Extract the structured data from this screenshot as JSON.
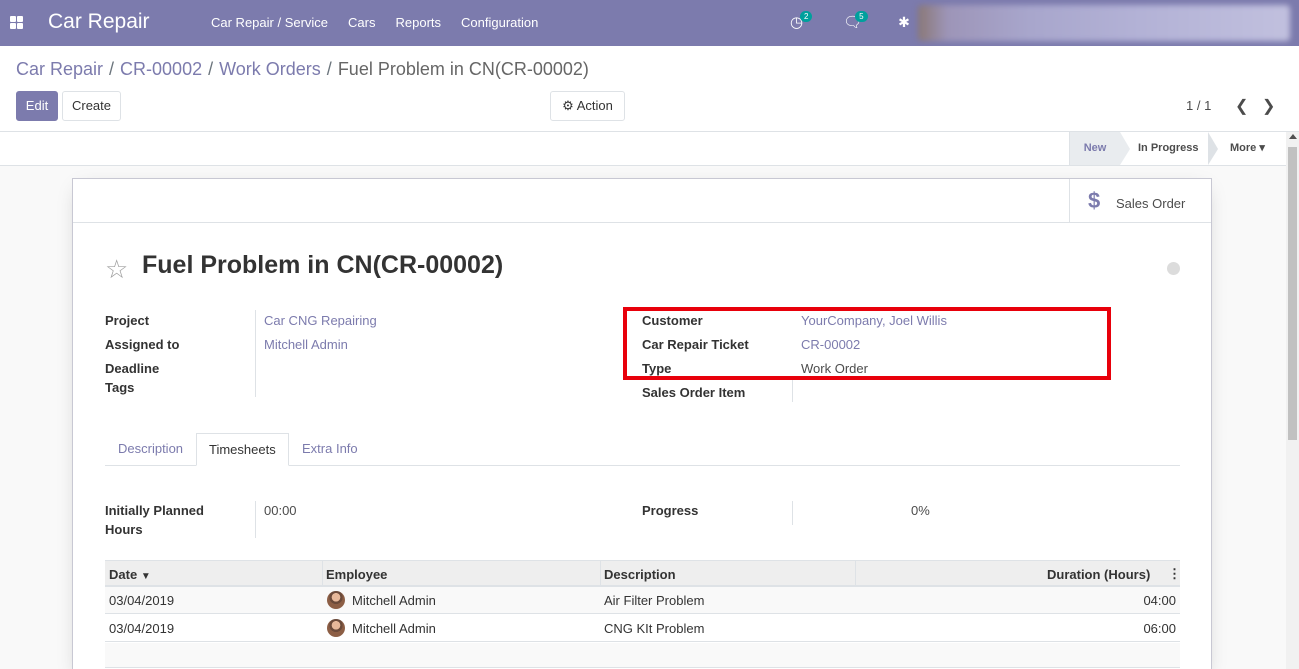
{
  "navbar": {
    "brand": "Car Repair",
    "menu": [
      "Car Repair / Service",
      "Cars",
      "Reports",
      "Configuration"
    ],
    "activity_count": "2",
    "messages_count": "5"
  },
  "breadcrumb": {
    "items": [
      "Car Repair",
      "CR-00002",
      "Work Orders"
    ],
    "current": "Fuel Problem in CN(CR-00002)"
  },
  "buttons": {
    "edit": "Edit",
    "create": "Create",
    "action": "Action"
  },
  "pager": {
    "value": "1 / 1"
  },
  "statusbar": {
    "stages": [
      "New",
      "In Progress",
      "More"
    ],
    "active": "New"
  },
  "smart_button": {
    "label": "Sales Order",
    "icon": "dollar-icon"
  },
  "record": {
    "title": "Fuel Problem in CN(CR-00002)",
    "left_fields": [
      {
        "label": "Project",
        "value": "Car CNG Repairing"
      },
      {
        "label": "Assigned to",
        "value": "Mitchell Admin"
      },
      {
        "label": "Deadline",
        "value": ""
      },
      {
        "label": "Tags",
        "value": ""
      }
    ],
    "right_fields": [
      {
        "label": "Customer",
        "value": "YourCompany, Joel Willis"
      },
      {
        "label": "Car Repair Ticket",
        "value": "CR-00002"
      },
      {
        "label": "Type",
        "value": "Work Order"
      },
      {
        "label": "Sales Order Item",
        "value": ""
      }
    ]
  },
  "tabs": [
    "Description",
    "Timesheets",
    "Extra Info"
  ],
  "active_tab": "Timesheets",
  "timesheet_summary": {
    "planned_label": "Initially Planned Hours",
    "planned_label_line1": "Initially Planned",
    "planned_label_line2": "Hours",
    "planned_value": "00:00",
    "progress_label": "Progress",
    "progress_value": "0%"
  },
  "table": {
    "columns": [
      "Date",
      "Employee",
      "Description",
      "Duration (Hours)"
    ],
    "rows": [
      {
        "date": "03/04/2019",
        "employee": "Mitchell Admin",
        "description": "Air Filter Problem",
        "duration": "04:00"
      },
      {
        "date": "03/04/2019",
        "employee": "Mitchell Admin",
        "description": "CNG KIt Problem",
        "duration": "06:00"
      }
    ]
  },
  "colors": {
    "brand": "#7c7bad",
    "highlight": "#e8000b",
    "badge": "#00a09d"
  }
}
